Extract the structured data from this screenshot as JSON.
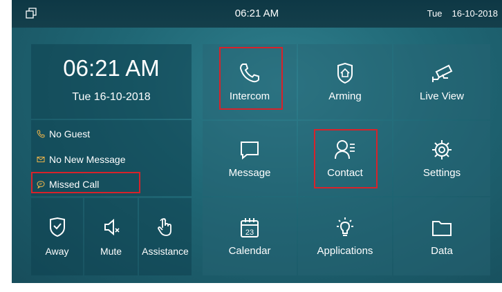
{
  "topbar": {
    "time": "06:21 AM",
    "day": "Tue",
    "date": "16-10-2018"
  },
  "clock": {
    "time": "06:21 AM",
    "date": "Tue 16-10-2018"
  },
  "status": [
    {
      "label": "No Guest",
      "icon": "phone-icon"
    },
    {
      "label": "No New Message",
      "icon": "envelope-icon"
    },
    {
      "label": "Missed Call",
      "icon": "chat-bubble-icon"
    }
  ],
  "bottom": {
    "away": "Away",
    "mute": "Mute",
    "assistance": "Assistance"
  },
  "grid": {
    "intercom": "Intercom",
    "arming": "Arming",
    "live_view": "Live View",
    "message": "Message",
    "contact": "Contact",
    "settings": "Settings",
    "calendar": "Calendar",
    "calendar_day": "23",
    "applications": "Applications",
    "data": "Data"
  },
  "colors": {
    "highlight": "#d8222a",
    "status_icon": "#f0b64a",
    "background": "#1f6674"
  }
}
